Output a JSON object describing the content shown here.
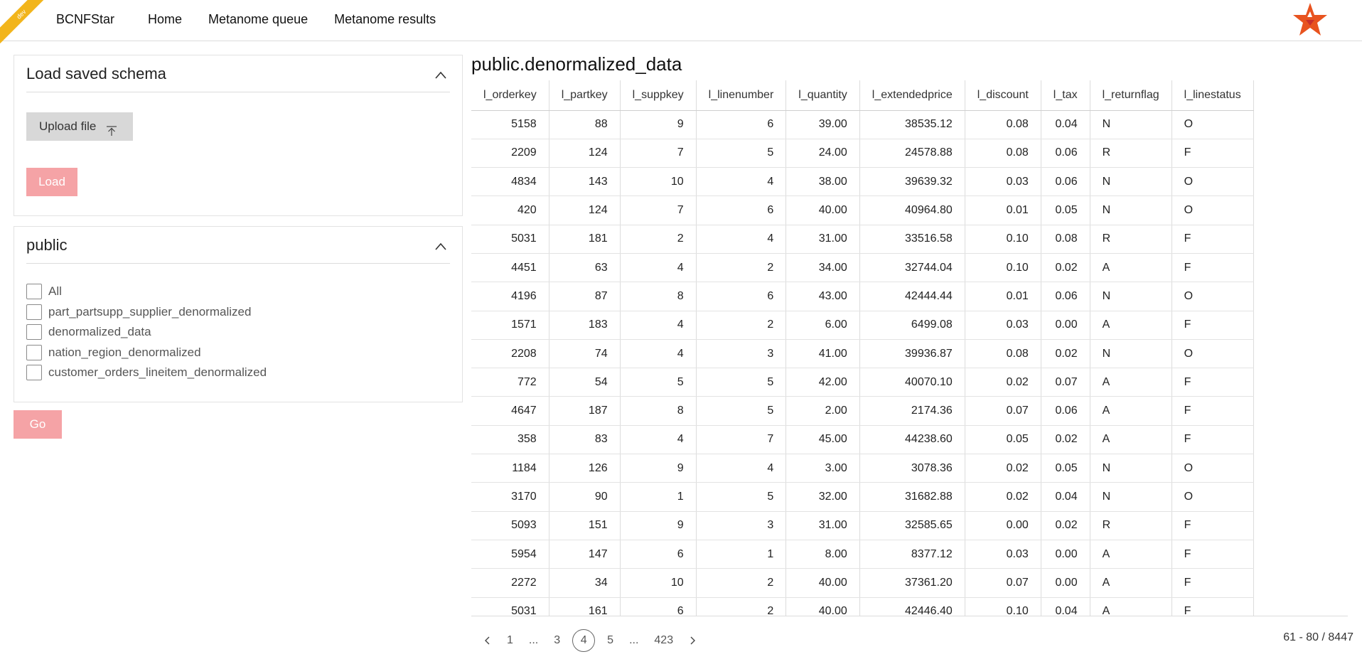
{
  "header": {
    "env_ribbon": "dev",
    "brand": "BCNFStar",
    "nav": [
      "Home",
      "Metanome queue",
      "Metanome results"
    ],
    "logo_icon": "star-logo-icon"
  },
  "schema_panel": {
    "title": "Load saved schema",
    "upload_label": "Upload file",
    "load_label": "Load"
  },
  "public_panel": {
    "title": "public",
    "items": [
      "All",
      "part_partsupp_supplier_denormalized",
      "denormalized_data",
      "nation_region_denormalized",
      "customer_orders_lineitem_denormalized"
    ],
    "go_label": "Go"
  },
  "table": {
    "title": "public.denormalized_data",
    "columns": [
      "l_orderkey",
      "l_partkey",
      "l_suppkey",
      "l_linenumber",
      "l_quantity",
      "l_extendedprice",
      "l_discount",
      "l_tax",
      "l_returnflag",
      "l_linestatus"
    ],
    "rows": [
      [
        "5158",
        "88",
        "9",
        "6",
        "39.00",
        "38535.12",
        "0.08",
        "0.04",
        "N",
        "O"
      ],
      [
        "2209",
        "124",
        "7",
        "5",
        "24.00",
        "24578.88",
        "0.08",
        "0.06",
        "R",
        "F"
      ],
      [
        "4834",
        "143",
        "10",
        "4",
        "38.00",
        "39639.32",
        "0.03",
        "0.06",
        "N",
        "O"
      ],
      [
        "420",
        "124",
        "7",
        "6",
        "40.00",
        "40964.80",
        "0.01",
        "0.05",
        "N",
        "O"
      ],
      [
        "5031",
        "181",
        "2",
        "4",
        "31.00",
        "33516.58",
        "0.10",
        "0.08",
        "R",
        "F"
      ],
      [
        "4451",
        "63",
        "4",
        "2",
        "34.00",
        "32744.04",
        "0.10",
        "0.02",
        "A",
        "F"
      ],
      [
        "4196",
        "87",
        "8",
        "6",
        "43.00",
        "42444.44",
        "0.01",
        "0.06",
        "N",
        "O"
      ],
      [
        "1571",
        "183",
        "4",
        "2",
        "6.00",
        "6499.08",
        "0.03",
        "0.00",
        "A",
        "F"
      ],
      [
        "2208",
        "74",
        "4",
        "3",
        "41.00",
        "39936.87",
        "0.08",
        "0.02",
        "N",
        "O"
      ],
      [
        "772",
        "54",
        "5",
        "5",
        "42.00",
        "40070.10",
        "0.02",
        "0.07",
        "A",
        "F"
      ],
      [
        "4647",
        "187",
        "8",
        "5",
        "2.00",
        "2174.36",
        "0.07",
        "0.06",
        "A",
        "F"
      ],
      [
        "358",
        "83",
        "4",
        "7",
        "45.00",
        "44238.60",
        "0.05",
        "0.02",
        "A",
        "F"
      ],
      [
        "1184",
        "126",
        "9",
        "4",
        "3.00",
        "3078.36",
        "0.02",
        "0.05",
        "N",
        "O"
      ],
      [
        "3170",
        "90",
        "1",
        "5",
        "32.00",
        "31682.88",
        "0.02",
        "0.04",
        "N",
        "O"
      ],
      [
        "5093",
        "151",
        "9",
        "3",
        "31.00",
        "32585.65",
        "0.00",
        "0.02",
        "R",
        "F"
      ],
      [
        "5954",
        "147",
        "6",
        "1",
        "8.00",
        "8377.12",
        "0.03",
        "0.00",
        "A",
        "F"
      ],
      [
        "2272",
        "34",
        "10",
        "2",
        "40.00",
        "37361.20",
        "0.07",
        "0.00",
        "A",
        "F"
      ],
      [
        "5031",
        "161",
        "6",
        "2",
        "40.00",
        "42446.40",
        "0.10",
        "0.04",
        "A",
        "F"
      ]
    ]
  },
  "pagination": {
    "pages": [
      "1",
      "...",
      "3",
      "4",
      "5",
      "...",
      "423"
    ],
    "current": "4",
    "range": "61 - 80 / 8447"
  },
  "colors": {
    "ribbon": "#f2b51c",
    "disabled_button": "#f5a3a6",
    "logo_orange": "#e8531f",
    "logo_red": "#c9302c"
  }
}
